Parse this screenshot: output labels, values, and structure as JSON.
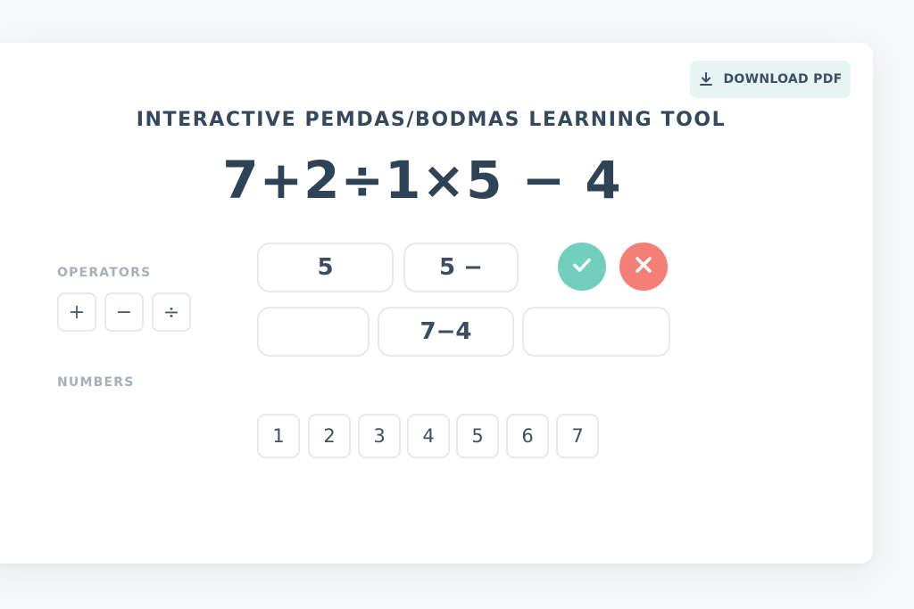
{
  "header": {
    "download_label": "DOWNLOAD PDF",
    "download_icon": "download-icon"
  },
  "title": "INTERACTIVE PEMDAS/BODMAS LEARNING TOOL",
  "expression": "7+2÷1×5 − 4",
  "operators": {
    "label": "OPERATORS",
    "items": [
      "+",
      "−",
      "÷"
    ]
  },
  "workspace": {
    "row1": [
      "5",
      "5 −"
    ],
    "row2": [
      "",
      "7−4",
      ""
    ]
  },
  "actions": {
    "check_icon": "check-icon",
    "check_color": "#72cfbd",
    "clear_icon": "close-icon",
    "clear_color": "#f47f77"
  },
  "numbers": {
    "label": "NUMBERS",
    "items": [
      "1",
      "2",
      "3",
      "4",
      "5",
      "6",
      "7"
    ]
  }
}
